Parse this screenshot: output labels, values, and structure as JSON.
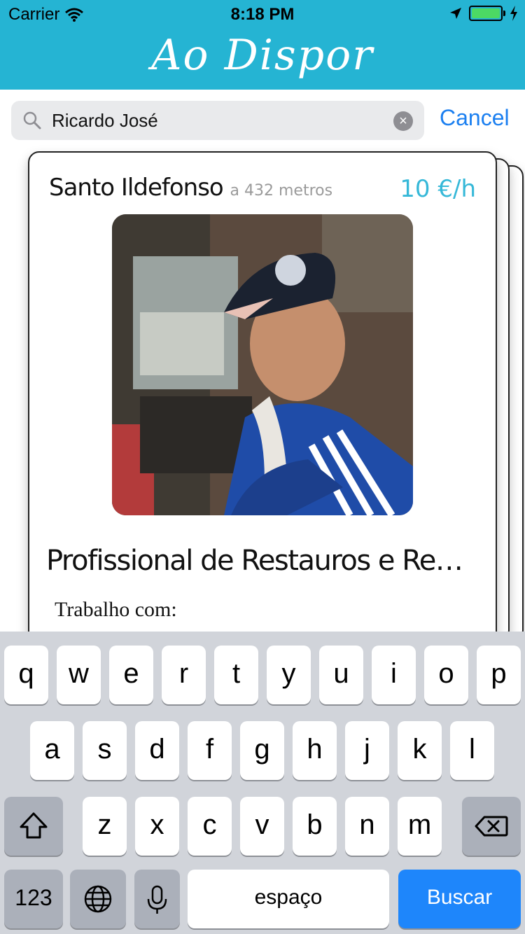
{
  "status_bar": {
    "carrier": "Carrier",
    "time": "8:18 PM"
  },
  "app": {
    "brand": "Ao Dispor"
  },
  "search": {
    "value": "Ricardo José",
    "cancel_label": "Cancel"
  },
  "card": {
    "location": "Santo Ildefonso",
    "distance": "a 432 metros",
    "price": "10 €/h",
    "title": "Profissional de Restauros e Remodel...",
    "description": "Trabalho com:"
  },
  "keyboard": {
    "row1": [
      "q",
      "w",
      "e",
      "r",
      "t",
      "y",
      "u",
      "i",
      "o",
      "p"
    ],
    "row2": [
      "a",
      "s",
      "d",
      "f",
      "g",
      "h",
      "j",
      "k",
      "l"
    ],
    "row3": [
      "z",
      "x",
      "c",
      "v",
      "b",
      "n",
      "m"
    ],
    "numbers_label": "123",
    "space_label": "espaço",
    "search_label": "Buscar"
  },
  "colors": {
    "header": "#25b4d3",
    "price": "#36b8d8",
    "accent": "#1b7ff0",
    "search_key": "#1e86fb"
  },
  "icons": [
    "wifi-icon",
    "location-arrow-icon",
    "battery-icon",
    "charging-icon",
    "search-icon",
    "clear-icon",
    "shift-icon",
    "backspace-icon",
    "globe-icon",
    "microphone-icon"
  ]
}
